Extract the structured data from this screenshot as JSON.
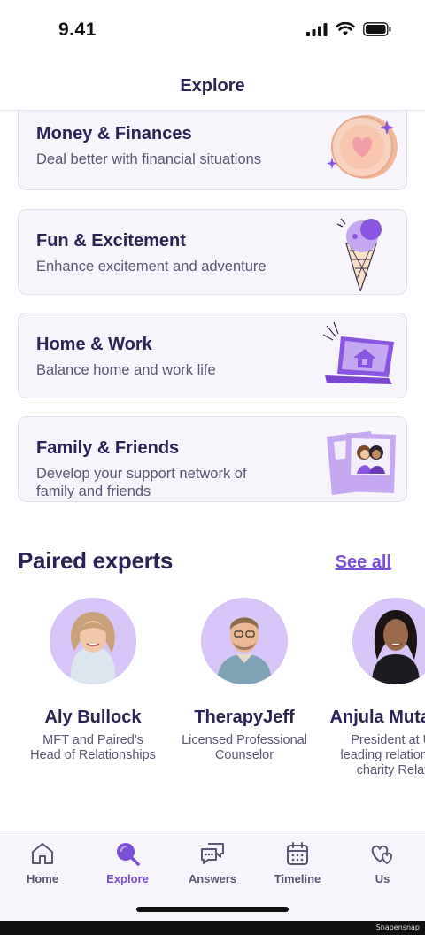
{
  "status": {
    "time": "9.41"
  },
  "header": {
    "title": "Explore"
  },
  "topics": [
    {
      "title": "Money & Finances",
      "desc": "Deal better with financial situations",
      "icon": "coin-heart-icon"
    },
    {
      "title": "Fun & Excitement",
      "desc": "Enhance excitement and adventure",
      "icon": "ice-cream-icon"
    },
    {
      "title": "Home & Work",
      "desc": "Balance home and work life",
      "icon": "laptop-house-icon"
    },
    {
      "title": "Family & Friends",
      "desc": "Develop your support network of family and friends",
      "icon": "photos-icon"
    }
  ],
  "experts_section": {
    "title": "Paired experts",
    "see_all": "See all"
  },
  "experts": [
    {
      "name": "Aly Bullock",
      "role": "MFT and Paired's Head of Relationships"
    },
    {
      "name": "TherapyJeff",
      "role": "Licensed Professional Counselor"
    },
    {
      "name": "Anjula Mutanda",
      "role": "President at UK leading relationship charity Relate"
    }
  ],
  "tabs": [
    {
      "label": "Home",
      "icon": "home-icon"
    },
    {
      "label": "Explore",
      "icon": "search-icon",
      "active": true
    },
    {
      "label": "Answers",
      "icon": "chat-bubbles-icon"
    },
    {
      "label": "Timeline",
      "icon": "calendar-icon"
    },
    {
      "label": "Us",
      "icon": "hearts-icon"
    }
  ],
  "colors": {
    "accent": "#7b4fd6",
    "text": "#2b2356",
    "card_bg": "#f8f4fb",
    "avatar_bg": "#d7c5f7"
  },
  "watermark": "Snapensnap"
}
